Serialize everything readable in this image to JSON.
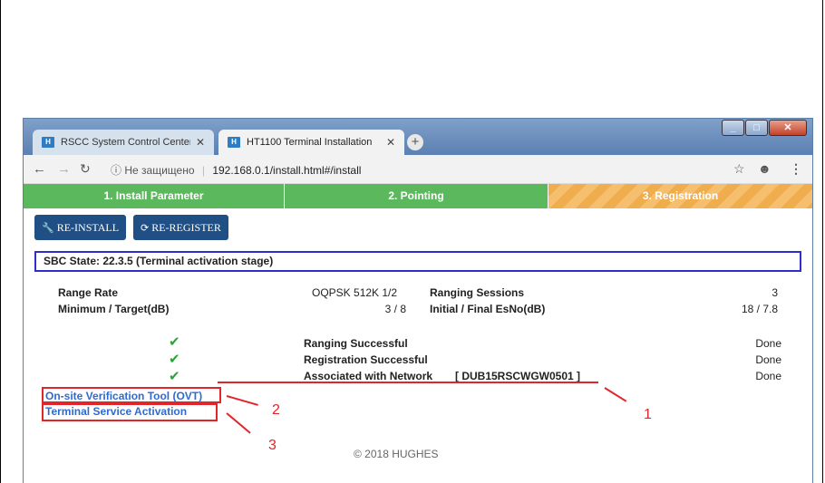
{
  "browser": {
    "tabs": [
      {
        "label": "RSCC System Control Center"
      },
      {
        "label": "HT1100 Terminal Installation"
      }
    ],
    "address": {
      "security": "Не защищено",
      "url": "192.168.0.1/install.html#/install"
    }
  },
  "steps": [
    {
      "label": "1. Install Parameter"
    },
    {
      "label": "2. Pointing"
    },
    {
      "label": "3. Registration"
    }
  ],
  "actions": {
    "reinstall": "RE-INSTALL",
    "reregister": "RE-REGISTER"
  },
  "sbc_state": "SBC State: 22.3.5 (Terminal activation stage)",
  "params": {
    "range_rate_label": "Range Rate",
    "range_rate_value": "OQPSK 512K 1/2",
    "ranging_sessions_label": "Ranging Sessions",
    "ranging_sessions_value": "3",
    "min_target_label": "Minimum / Target(dB)",
    "min_target_value": "3 / 8",
    "esno_label": "Initial / Final EsNo(dB)",
    "esno_value": "18 / 7.8"
  },
  "checks": [
    {
      "label": "Ranging Successful",
      "status": "Done"
    },
    {
      "label": "Registration Successful",
      "status": "Done"
    },
    {
      "label": "Associated with Network",
      "network": "[ DUB15RSCWGW0501 ]",
      "status": "Done"
    }
  ],
  "links": {
    "ovt": "On-site Verification Tool (OVT)",
    "activation": "Terminal Service Activation"
  },
  "annotations": {
    "one": "1",
    "two": "2",
    "three": "3"
  },
  "footer": "© 2018 HUGHES",
  "colors": {
    "step_green": "#5cb85c",
    "step_orange": "#f0ad4e",
    "button_blue": "#1f4f85",
    "annotation_red": "#e0252b",
    "link_blue": "#2e6bd0",
    "check_green": "#27a537"
  }
}
